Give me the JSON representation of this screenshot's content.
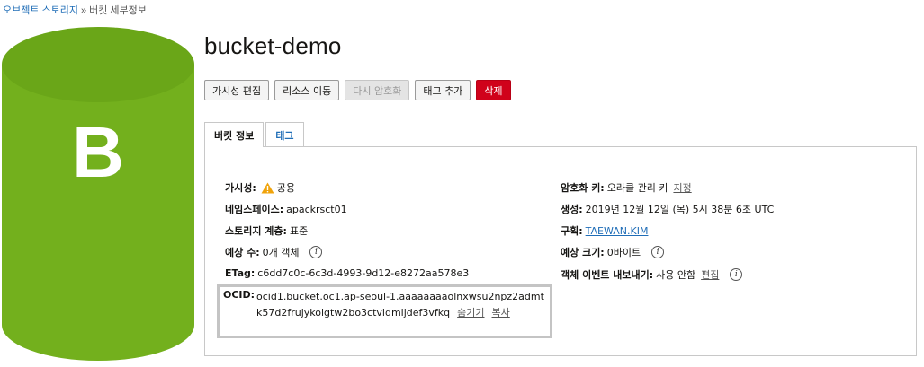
{
  "breadcrumb": {
    "parent": "오브젝트 스토리지",
    "separator": "»",
    "current": "버킷 세부정보"
  },
  "bucket": {
    "initial": "B",
    "name": "bucket-demo",
    "color": "#6fae1c"
  },
  "actions": {
    "edit_visibility": "가시성 편집",
    "move_resource": "리소스 이동",
    "re_encrypt": "다시 암호화",
    "add_tags": "태그 추가",
    "delete": "삭제"
  },
  "tabs": {
    "bucket_info": "버킷 정보",
    "tags": "태그"
  },
  "details": {
    "visibility": {
      "label": "가시성:",
      "value": "공용"
    },
    "namespace": {
      "label": "네임스페이스:",
      "value": "apackrsct01"
    },
    "storage_tier": {
      "label": "스토리지 계층:",
      "value": "표준"
    },
    "approx_count": {
      "label": "예상 수:",
      "value": "0개 객체"
    },
    "etag": {
      "label": "ETag:",
      "value": "c6dd7c0c-6c3d-4993-9d12-e8272aa578e3"
    },
    "ocid": {
      "label": "OCID:",
      "value": "ocid1.bucket.oc1.ap-seoul-1.aaaaaaaaolnxwsu2npz2admtk57d2frujykolgtw2bo3ctvldmijdef3vfkq",
      "hide": "숨기기",
      "copy": "복사"
    },
    "encryption_key": {
      "label": "암호화 키:",
      "value": "오라클 관리 키",
      "assign": "지정"
    },
    "created": {
      "label": "생성:",
      "value": "2019년 12월 12일 (목) 5시 38분 6초 UTC"
    },
    "compartment": {
      "label": "구획:",
      "value": "TAEWAN.KIM"
    },
    "approx_size": {
      "label": "예상 크기:",
      "value": "0바이트"
    },
    "object_events": {
      "label": "객체 이벤트 내보내기:",
      "value": "사용 안함",
      "edit": "편집"
    }
  },
  "icons": {
    "warning": "warning-icon",
    "info": "info-icon"
  }
}
